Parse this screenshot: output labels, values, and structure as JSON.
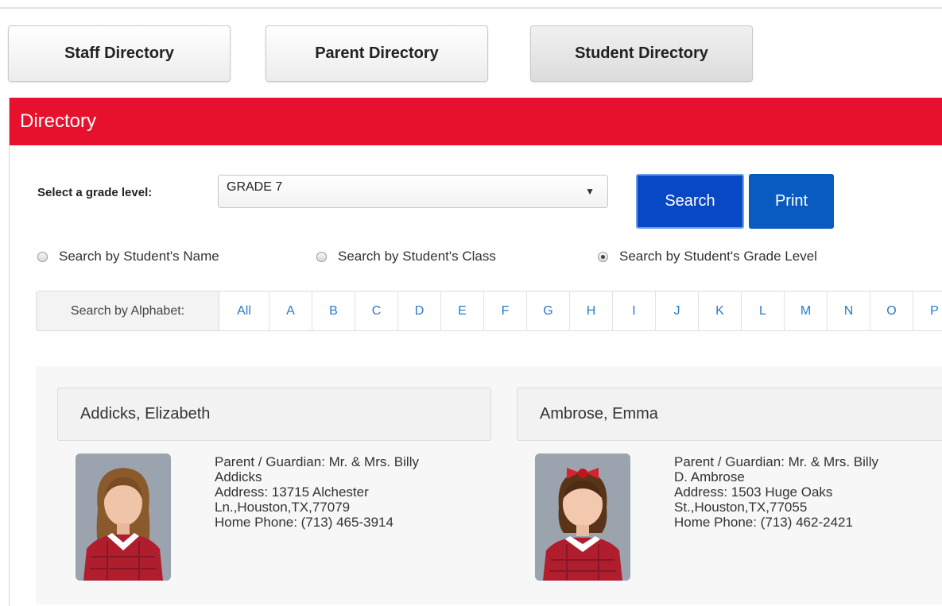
{
  "tabs": [
    "Staff Directory",
    "Parent Directory",
    "Student Directory"
  ],
  "panel": {
    "title": "Directory"
  },
  "grade": {
    "label": "Select a grade level:",
    "selected": "GRADE 7"
  },
  "buttons": {
    "search": "Search",
    "print": "Print"
  },
  "search_modes": [
    {
      "label": "Search by Student's Name",
      "checked": false
    },
    {
      "label": "Search by Student's Class",
      "checked": false
    },
    {
      "label": "Search by Student's Grade Level",
      "checked": true
    }
  ],
  "alphabet": {
    "label": "Search by Alphabet:",
    "letters": [
      "All",
      "A",
      "B",
      "C",
      "D",
      "E",
      "F",
      "G",
      "H",
      "I",
      "J",
      "K",
      "L",
      "M",
      "N",
      "O",
      "P"
    ]
  },
  "students": [
    {
      "name": "Addicks, Elizabeth",
      "lines": [
        "Parent / Guardian: Mr. & Mrs. Billy",
        "Addicks",
        "Address: 13715 Alchester",
        "Ln.,Houston,TX,77079",
        "Home Phone: (713) 465-3914"
      ]
    },
    {
      "name": "Ambrose, Emma",
      "lines": [
        "Parent / Guardian: Mr. & Mrs. Billy",
        "D. Ambrose",
        "Address: 1503 Huge Oaks",
        "St.,Houston,TX,77055",
        "Home Phone: (713) 462-2421"
      ]
    }
  ]
}
